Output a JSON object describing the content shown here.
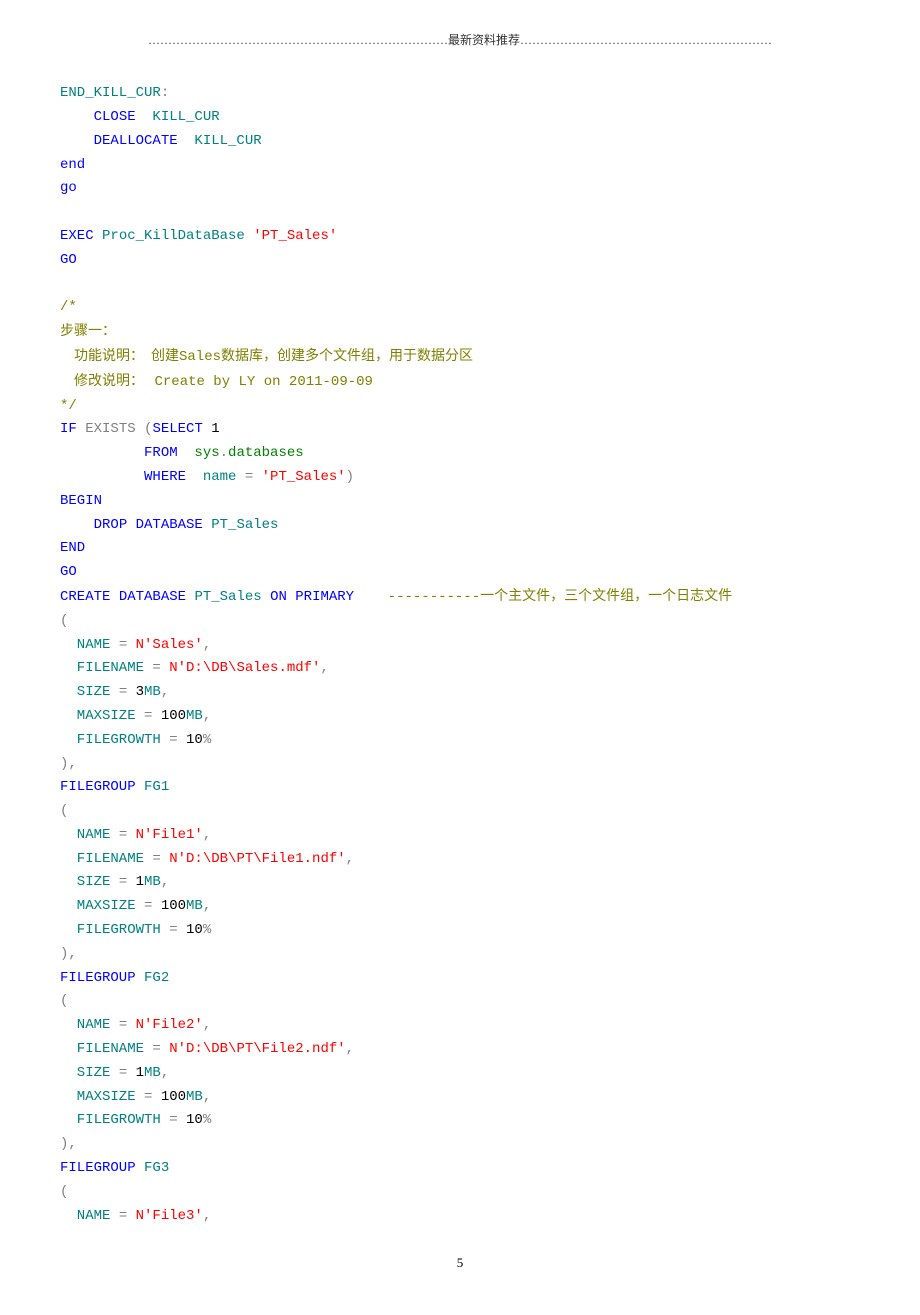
{
  "header": "…………………………………………………………………最新资料推荐………………………………………………………",
  "page_number": "5",
  "code": {
    "l1a": "END_KILL_CUR",
    "l1b": ":",
    "l2a": "CLOSE",
    "l2b": "  KILL_CUR",
    "l3a": "DEALLOCATE",
    "l3b": "  KILL_CUR",
    "l4": "end",
    "l5": "go",
    "l7a": "EXEC",
    "l7b": " Proc_KillDataBase ",
    "l7c": "'PT_Sales'",
    "l8": "GO",
    "l10": "/*",
    "l11": "步骤一：",
    "l12a": "    功能说明：  创建",
    "l12b": "Sales",
    "l12c": "数据库，创建多个文件组，用于数据分区",
    "l13a": "    修改说明：   ",
    "l13b": "Create by LY on 2011-09-09",
    "l14": "*/",
    "l15a": "IF",
    "l15b": " EXISTS ",
    "l15c": "(",
    "l15d": "SELECT",
    "l15e": " 1",
    "l16a": "FROM",
    "l16b": "  sys",
    "l16c": ".",
    "l16d": "databases",
    "l17a": "WHERE",
    "l17b": "  name ",
    "l17c": "=",
    "l17d": " 'PT_Sales'",
    "l17e": ")",
    "l18": "BEGIN",
    "l19a": "DROP",
    "l19b": " DATABASE",
    "l19c": " PT_Sales",
    "l20": "END",
    "l21": "GO",
    "l22a": "CREATE",
    "l22b": " DATABASE",
    "l22c": " PT_Sales ",
    "l22d": "ON",
    "l22e": " PRIMARY",
    "l22f": "    -----------",
    "l22g": "一个主文件，三个文件组，一个日志文件",
    "l23": "(",
    "l24a": "  NAME ",
    "l24b": "=",
    "l24c": " N'Sales'",
    "l24d": ",",
    "l25a": "  FILENAME ",
    "l25b": "=",
    "l25c": " N'D:\\DB\\Sales.mdf'",
    "l25d": ",",
    "l26a": "  SIZE ",
    "l26b": "=",
    "l26c": " 3",
    "l26d": "MB",
    "l26e": ",",
    "l27a": "  MAXSIZE ",
    "l27b": "=",
    "l27c": " 100",
    "l27d": "MB",
    "l27e": ",",
    "l28a": "  FILEGROWTH ",
    "l28b": "=",
    "l28c": " 10",
    "l28d": "%",
    "l29": "),",
    "l30a": "FILEGROUP",
    "l30b": " FG1",
    "l31": "(",
    "l32a": "  NAME ",
    "l32b": "=",
    "l32c": " N'File1'",
    "l32d": ",",
    "l33a": "  FILENAME ",
    "l33b": "=",
    "l33c": " N'D:\\DB\\PT\\File1.ndf'",
    "l33d": ",",
    "l34a": "  SIZE ",
    "l34b": "=",
    "l34c": " 1",
    "l34d": "MB",
    "l34e": ",",
    "l35a": "  MAXSIZE ",
    "l35b": "=",
    "l35c": " 100",
    "l35d": "MB",
    "l35e": ",",
    "l36a": "  FILEGROWTH ",
    "l36b": "=",
    "l36c": " 10",
    "l36d": "%",
    "l37": "),",
    "l38a": "FILEGROUP",
    "l38b": " FG2",
    "l39": "(",
    "l40a": "  NAME ",
    "l40b": "=",
    "l40c": " N'File2'",
    "l40d": ",",
    "l41a": "  FILENAME ",
    "l41b": "=",
    "l41c": " N'D:\\DB\\PT\\File2.ndf'",
    "l41d": ",",
    "l42a": "  SIZE ",
    "l42b": "=",
    "l42c": " 1",
    "l42d": "MB",
    "l42e": ",",
    "l43a": "  MAXSIZE ",
    "l43b": "=",
    "l43c": " 100",
    "l43d": "MB",
    "l43e": ",",
    "l44a": "  FILEGROWTH ",
    "l44b": "=",
    "l44c": " 10",
    "l44d": "%",
    "l45": "),",
    "l46a": "FILEGROUP",
    "l46b": " FG3",
    "l47": "(",
    "l48a": "  NAME ",
    "l48b": "=",
    "l48c": " N'File3'",
    "l48d": ","
  }
}
